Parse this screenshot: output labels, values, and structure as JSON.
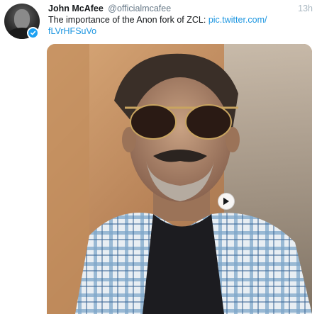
{
  "tweet": {
    "author": {
      "display_name": "John McAfee",
      "handle": "@officialmcafee",
      "verified": true,
      "avatar_icon": "profile-photo"
    },
    "timestamp": "13h",
    "text_plain": "The importance of the Anon fork of ZCL: ",
    "text_link_line1": "pic.twitter.com/",
    "text_link_line2": "fLVrHFSuVo",
    "media": {
      "type": "video",
      "play_icon": "play-icon"
    }
  },
  "colors": {
    "link": "#1b95e0",
    "verified_badge": "#1da1f2",
    "handle": "#657786",
    "timestamp": "#aab8c2",
    "text": "#14171a"
  }
}
